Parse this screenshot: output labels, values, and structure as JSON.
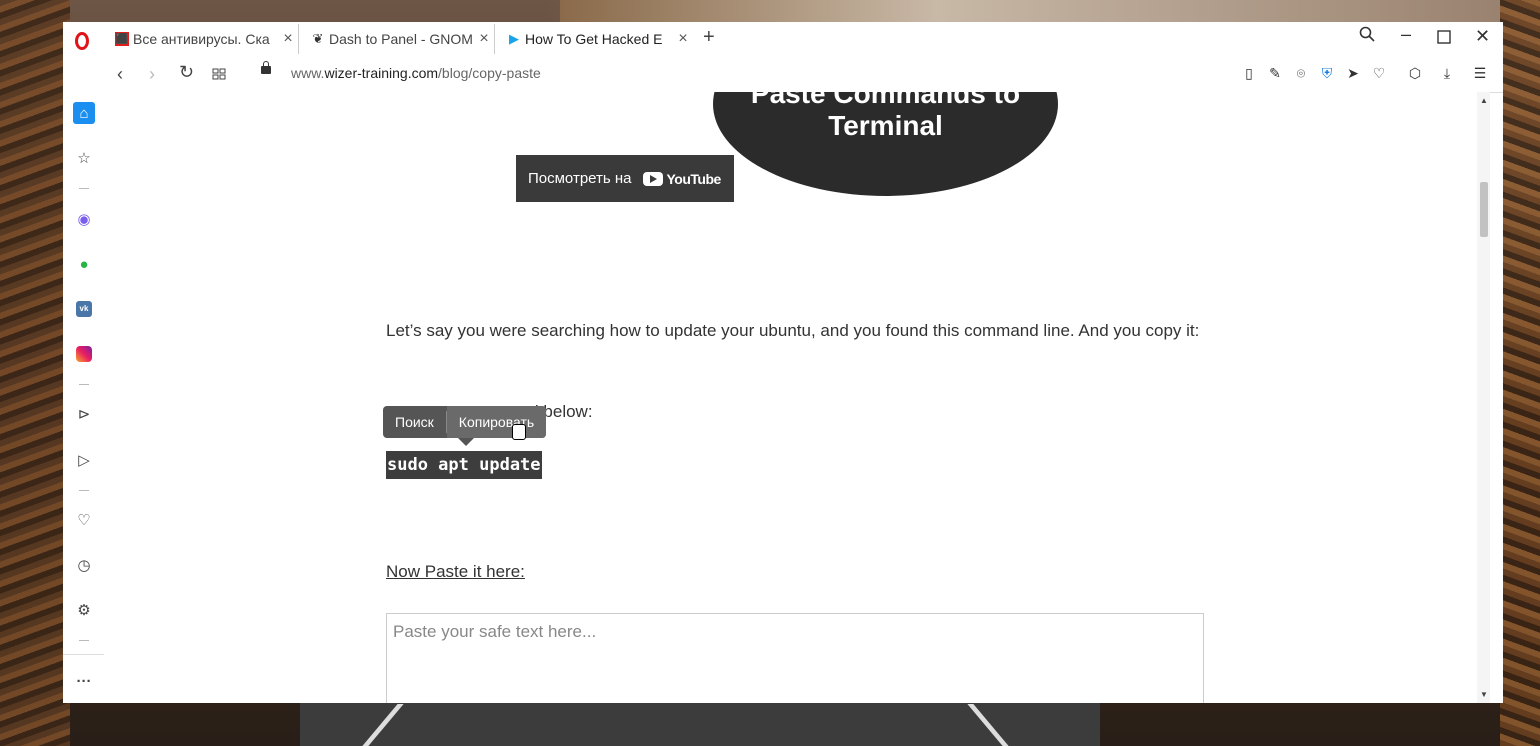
{
  "browser": {
    "tabs": [
      {
        "title": "Все антивирусы. Ска",
        "favicon": "antivirus-icon",
        "color": "#e21b1b"
      },
      {
        "title": "Dash to Panel - GNOM",
        "favicon": "gnome-foot-icon",
        "color": "#333333"
      },
      {
        "title": "How To Get Hacked E",
        "favicon": "wizer-icon",
        "color": "#1aa3e8"
      }
    ],
    "new_tab": "+",
    "url_prefix": "www.",
    "url_domain": "wizer-training.com",
    "url_path": "/blog/copy-paste",
    "accent": "#e0131a"
  },
  "sidebar": {
    "items": [
      "home-icon",
      "bookmarks-icon",
      "messenger-icon",
      "whatsapp-icon",
      "vk-icon",
      "instagram-icon",
      "player-icon",
      "send-icon",
      "heart-icon",
      "history-icon",
      "settings-icon",
      "more-icon"
    ],
    "more_label": "···"
  },
  "page": {
    "bubble_line1": "Paste Commands to",
    "bubble_line2": "Terminal",
    "youtube_watch": "Посмотреть на",
    "youtube_brand": "YouTube",
    "paragraph": "Let’s say you were searching how to update your ubuntu, and you found this command line. And you copy it:",
    "copy_instruction": "mmand below:",
    "command": "sudo apt update",
    "paste_label": "Now Paste it here:",
    "paste_placeholder": "Paste your safe text here..."
  },
  "context_popup": {
    "search_label": "Поиск",
    "copy_label": "Копировать"
  }
}
